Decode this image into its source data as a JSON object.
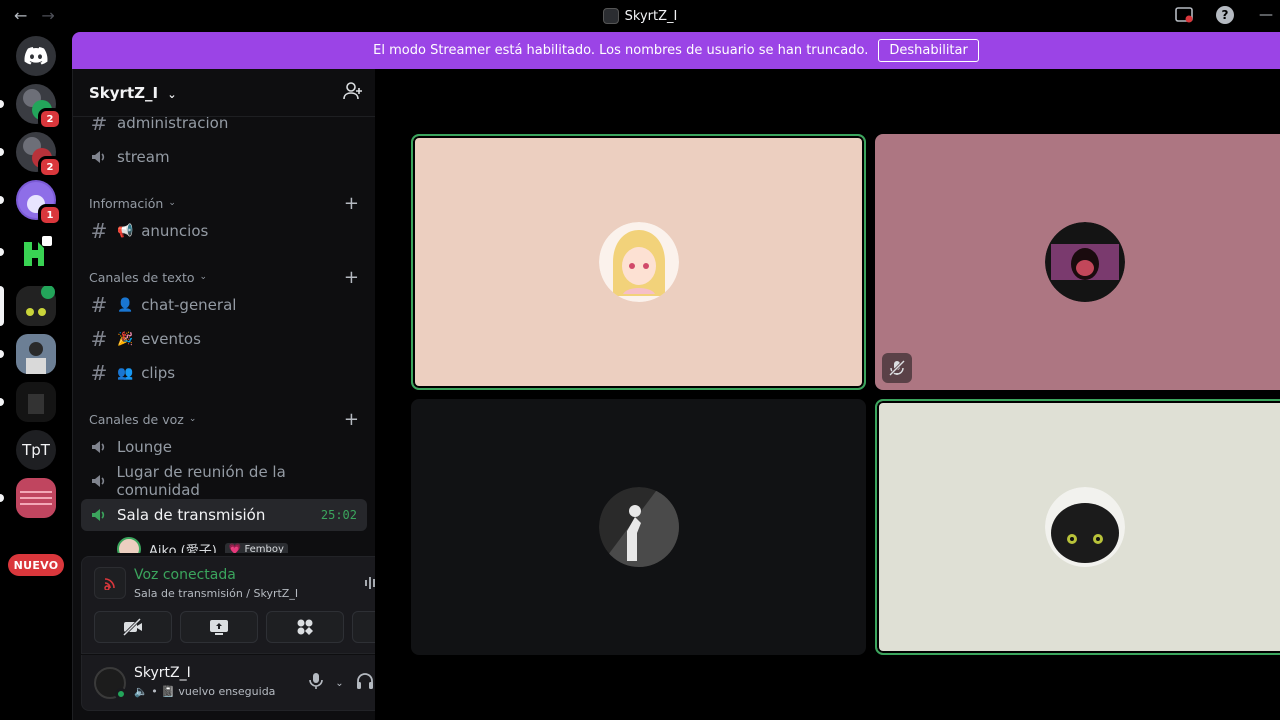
{
  "window": {
    "title": "SkyrtZ_I"
  },
  "banner": {
    "text": "El modo Streamer está habilitado. Los nombres de usuario se han truncado.",
    "button": "Deshabilitar"
  },
  "guilds": {
    "badges": [
      "2",
      "2",
      "1"
    ],
    "tpt_label": "TpT",
    "new_label": "NUEVO"
  },
  "server": {
    "name": "SkyrtZ_I"
  },
  "channels": {
    "top": [
      {
        "name": "administracion",
        "type": "text"
      },
      {
        "name": "stream",
        "type": "stage"
      }
    ],
    "categories": [
      {
        "name": "Información",
        "items": [
          {
            "emoji": "📢",
            "name": "anuncios"
          }
        ]
      },
      {
        "name": "Canales de texto",
        "items": [
          {
            "emoji": "👤",
            "name": "chat-general"
          },
          {
            "emoji": "🎉",
            "name": "eventos"
          },
          {
            "emoji": "👥",
            "name": "clips"
          }
        ]
      },
      {
        "name": "Canales de voz",
        "items": [
          {
            "name": "Lounge"
          },
          {
            "name": "Lugar de reunión de la comunidad"
          },
          {
            "name": "Sala de transmisión",
            "timer": "25:02"
          }
        ]
      }
    ],
    "voice_user": {
      "name": "Aiko (愛子)",
      "tag": "💗 Femboy"
    }
  },
  "voice_panel": {
    "title": "Voz conectada",
    "subtitle": "Sala de transmisión / SkyrtZ_I"
  },
  "user": {
    "name": "SkyrtZ_I",
    "status": "vuelvo enseguida"
  },
  "colors": {
    "accent": "#9b44e6",
    "speaking": "#3ba55d",
    "tile1": "#eccfc0",
    "tile2": "#ad7682",
    "tile3": "#111214",
    "tile4": "#dfe0d5"
  },
  "tiles": [
    {
      "user": "tile-user-1",
      "muted": false,
      "speaking": true
    },
    {
      "user": "tile-user-2",
      "muted": true,
      "speaking": false
    },
    {
      "user": "tile-user-3",
      "muted": false,
      "speaking": false
    },
    {
      "user": "tile-user-4",
      "muted": false,
      "speaking": true
    }
  ]
}
